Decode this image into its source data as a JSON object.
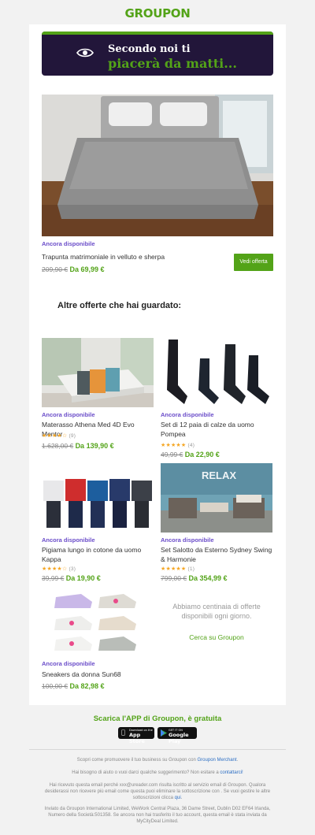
{
  "header": {
    "logo": "GROUPON"
  },
  "banner": {
    "line1": "Secondo noi ti",
    "line2": "piacerà da matti...",
    "icon": "eye-icon"
  },
  "featured": {
    "availability": "Ancora disponibile",
    "title": "Trapunta matrimoniale in velluto e sherpa",
    "old_price": "209,90 €",
    "new_price": "Da 69,99 €",
    "cta": "Vedi offerta"
  },
  "section_title": "Altre offerte che hai guardato:",
  "products": [
    {
      "availability": "Ancora disponibile",
      "title": "Materasso Athena Med 4D Evo Mentor",
      "stars": "★★★★☆",
      "reviews": "(9)",
      "old_price": "1.628,00 €",
      "new_price": "Da 139,90 €"
    },
    {
      "availability": "Ancora disponibile",
      "title": "Set di 12 paia di calze da uomo Pompea",
      "stars": "★★★★★",
      "reviews": "(4)",
      "old_price": "49,99 €",
      "new_price": "Da 22,90 €"
    },
    {
      "availability": "Ancora disponibile",
      "title": "Pigiama lungo in cotone da uomo Kappa",
      "stars": "★★★★☆",
      "reviews": "(3)",
      "old_price": "39,99 €",
      "new_price": "Da 19,90 €"
    },
    {
      "availability": "Ancora disponibile",
      "title": "Set Salotto da Esterno Sydney Swing & Harmonie",
      "stars": "★★★★★",
      "reviews": "(1)",
      "old_price": "799,00 €",
      "new_price": "Da 354,99 €"
    },
    {
      "availability": "Ancora disponibile",
      "title": "Sneakers da donna Sun68",
      "old_price": "100,00 €",
      "new_price": "Da 82,98 €"
    }
  ],
  "more": {
    "text": "Abbiamo centinaia di offerte disponibili ogni giorno.",
    "link": "Cerca su Groupon"
  },
  "relax_sign": "RELAX",
  "app": {
    "title": "Scarica l'APP di Groupon, è gratuita",
    "appstore_small": "Download on the",
    "appstore_big": "App Store",
    "googleplay_small": "GET IT ON",
    "googleplay_big": "Google Play"
  },
  "footer": {
    "merchant_pre": "Scopri come promuovere il tuo business su Groupon con ",
    "merchant_link": "Groupon Merchant",
    "merchant_post": ".",
    "help_pre": "Hai bisogno di aiuto o vuoi darci qualche suggerimento? Non esitare a ",
    "help_link": "contattarci!",
    "info1": "Hai ricevuto questa email perché xxx@ureader.com risulta iscritto al servizio email di Groupon. Qualora desiderassi non ricevere più email come questa puoi eliminare la sottoscrizione con . Se vuoi gestire le altre sottoscrizioni clicca ",
    "info1_link": "qui",
    "info1_post": ".",
    "legal": "Inviato da Groupon International Limited, WeWork Central Plaza, 36 Dame Street, Dublin D02 EF64 Irlanda, Numero della Società:501358. Se ancora non hai trasferito il tuo account, questa email è stata inviata da MyCityDeal Limited."
  },
  "colors": {
    "brand_green": "#53a318",
    "banner_bg": "#22163a",
    "availability_purple": "#6a4cc9",
    "star": "#f5a623"
  }
}
